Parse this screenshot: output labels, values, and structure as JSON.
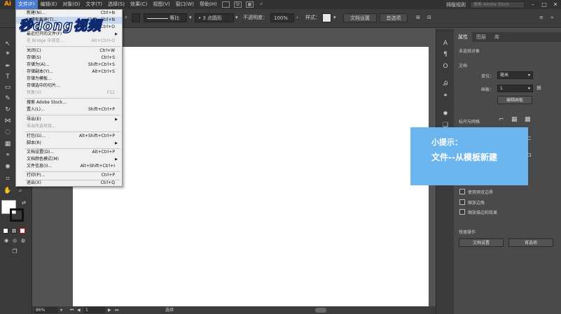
{
  "app": {
    "logo": "Ai"
  },
  "menubar": {
    "items": [
      "文件(F)",
      "编辑(E)",
      "对象(O)",
      "文字(T)",
      "选择(S)",
      "效果(C)",
      "视图(V)",
      "窗口(W)",
      "帮助(H)"
    ],
    "st_label": "St",
    "workspace": "排版规则",
    "stock_placeholder": "搜索 Adobe Stock"
  },
  "controlbar": {
    "stroke_style": "等比",
    "brush": "3 点圆形",
    "opacity_label": "不透明度：",
    "opacity_value": "100%",
    "style_label": "样式：",
    "doc_setup": "文档设置",
    "prefs": "首选项"
  },
  "file_menu": {
    "items": [
      {
        "label": "新建(N)...",
        "shortcut": "Ctrl+N",
        "enabled": true
      },
      {
        "label": "从模板新建(T)...",
        "shortcut": "Shift+Ctrl+N",
        "enabled": true,
        "highlighted": true
      },
      {
        "label": "打开(O)...",
        "shortcut": "Ctrl+O",
        "enabled": true
      },
      {
        "label": "最近打开的文件(F)",
        "shortcut": "",
        "enabled": true,
        "submenu": true
      },
      {
        "label": "在 Bridge 中浏览...",
        "shortcut": "Alt+Ctrl+O",
        "enabled": false
      },
      {
        "label": "关闭(C)",
        "shortcut": "Ctrl+W",
        "enabled": true
      },
      {
        "label": "存储(S)",
        "shortcut": "Ctrl+S",
        "enabled": true
      },
      {
        "label": "存储为(A)...",
        "shortcut": "Shift+Ctrl+S",
        "enabled": true
      },
      {
        "label": "存储副本(Y)...",
        "shortcut": "Alt+Ctrl+S",
        "enabled": true
      },
      {
        "label": "存储为模板...",
        "shortcut": "",
        "enabled": true
      },
      {
        "label": "存储选中的切片...",
        "shortcut": "",
        "enabled": true
      },
      {
        "label": "恢复(V)",
        "shortcut": "F12",
        "enabled": false
      },
      {
        "label": "搜索 Adobe Stock...",
        "shortcut": "",
        "enabled": true
      },
      {
        "label": "置入(L)...",
        "shortcut": "Shift+Ctrl+P",
        "enabled": true
      },
      {
        "label": "导出(E)",
        "shortcut": "",
        "enabled": true,
        "submenu": true
      },
      {
        "label": "导出所选项目...",
        "shortcut": "",
        "enabled": false
      },
      {
        "label": "打包(G)...",
        "shortcut": "Alt+Shift+Ctrl+P",
        "enabled": true
      },
      {
        "label": "脚本(R)",
        "shortcut": "",
        "enabled": true,
        "submenu": true
      },
      {
        "label": "文档设置(D)...",
        "shortcut": "Alt+Ctrl+P",
        "enabled": true
      },
      {
        "label": "文档颜色模式(M)",
        "shortcut": "",
        "enabled": true,
        "submenu": true
      },
      {
        "label": "文件信息(I)...",
        "shortcut": "Alt+Shift+Ctrl+I",
        "enabled": true
      },
      {
        "label": "打印(P)...",
        "shortcut": "Ctrl+P",
        "enabled": true
      },
      {
        "label": "退出(X)",
        "shortcut": "Ctrl+Q",
        "enabled": true
      }
    ]
  },
  "watermark": "秒dong视频",
  "tip": {
    "title": "小提示：",
    "text": "文件--从模板新建"
  },
  "props_panel": {
    "tabs": [
      "属性",
      "图层",
      "库"
    ],
    "no_selection": "未选择对象",
    "document_section": "文档",
    "unit_label": "单位：",
    "unit_value": "毫米",
    "artboard_label": "画板：",
    "artboard_value": "1",
    "edit_artboard": "编辑画板",
    "rulers_grid": "标尺与网格",
    "use_preview_bounds": "使用预览边界",
    "scale_corners": "缩放边角",
    "scale_strokes": "缩放描边和效果",
    "quick_actions": "快速操作",
    "doc_setup_btn": "文档设置",
    "prefs_btn": "首选项"
  },
  "statusbar": {
    "zoom": "86%",
    "artboard": "1",
    "mode": "选择"
  },
  "colors": {
    "accent": "#4b7bd1",
    "tip_bg": "#6bb6ee",
    "watermark_stroke": "#0f2a6e"
  }
}
